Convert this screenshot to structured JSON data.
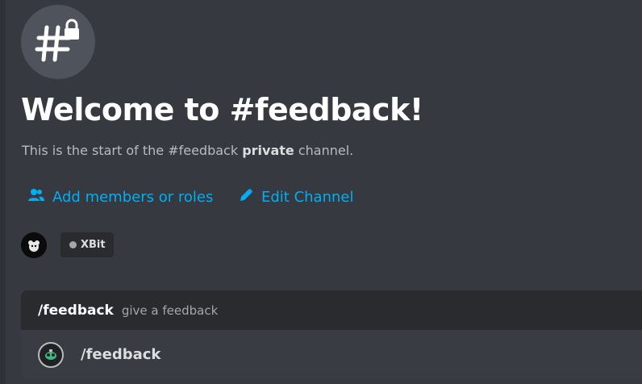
{
  "welcome": {
    "title": "Welcome to #feedback!",
    "desc_prefix": "This is the start of the #feedback ",
    "desc_bold": "private",
    "desc_suffix": " channel."
  },
  "actions": {
    "add_members": "Add members or roles",
    "edit_channel": "Edit Channel"
  },
  "members": {
    "role_label": "XBit"
  },
  "command_popup": {
    "command_name": "/feedback",
    "command_description": "give a feedback",
    "item_label": "/feedback"
  },
  "colors": {
    "background": "#36393f",
    "link": "#00aff4",
    "title": "#ffffff"
  },
  "icons": {
    "channel": "private-text-channel-icon",
    "add_members": "add-members-icon",
    "edit": "pencil-icon",
    "bot": "bot-avatar-icon"
  }
}
